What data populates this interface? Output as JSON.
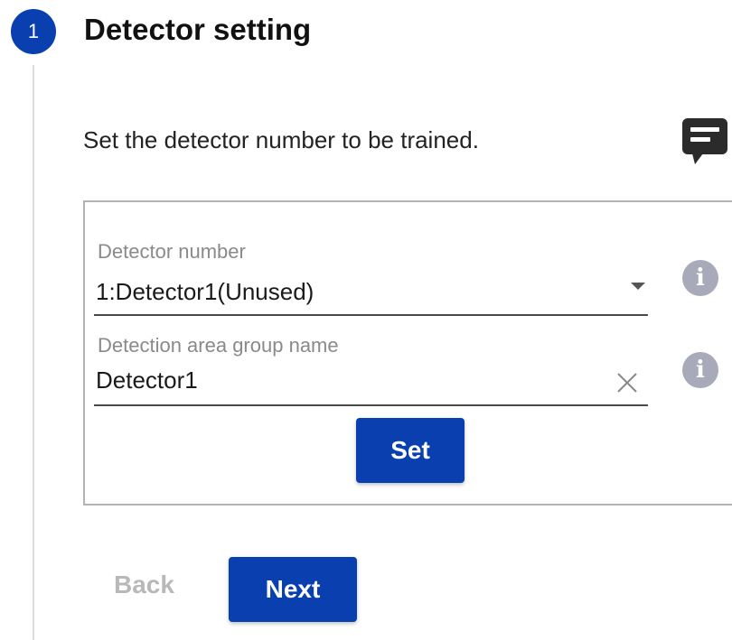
{
  "step": {
    "number": "1",
    "title": "Detector setting",
    "instruction": "Set the detector number to be trained."
  },
  "icons": {
    "chat": "chat-bubble-icon",
    "info": "info-icon",
    "clear": "close-icon",
    "dropdown": "chevron-down-icon"
  },
  "form": {
    "detector_number": {
      "label": "Detector number",
      "value": "1:Detector1(Unused)"
    },
    "group_name": {
      "label": "Detection area group name",
      "value": "Detector1"
    },
    "set_label": "Set",
    "info_glyph": "i"
  },
  "nav": {
    "back_label": "Back",
    "next_label": "Next"
  },
  "colors": {
    "primary": "#0a3fb0",
    "disabled_text": "#b8b8b8",
    "info_icon": "#a8a9b9"
  }
}
